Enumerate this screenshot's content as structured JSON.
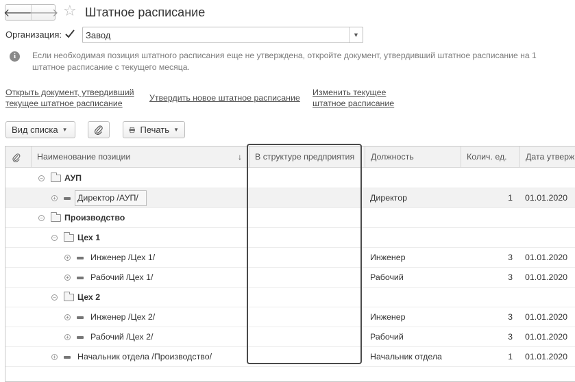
{
  "header": {
    "title": "Штатное расписание",
    "back_icon": "arrow-left-icon",
    "forward_icon": "arrow-right-icon",
    "favorite_icon": "star-icon"
  },
  "organization": {
    "label": "Организация:",
    "checked": true,
    "value": "Завод"
  },
  "info": {
    "line1": "Если необходимая позиция штатного расписания еще не утверждена, откройте документ, утвердивший штатное расписание на 1",
    "line2": "штатное расписание с текущего месяца."
  },
  "links": {
    "open_doc_line1": "Открыть документ, утвердивший",
    "open_doc_line2": "текущее штатное расписание",
    "approve_new": "Утвердить новое штатное расписание",
    "change_line1": "Изменить текущее",
    "change_line2": "штатное расписание"
  },
  "toolbar": {
    "view_list": "Вид списка",
    "attach_icon": "paperclip-icon",
    "print": "Печать"
  },
  "table": {
    "columns": {
      "attach": "paperclip-icon",
      "name": "Наименование позиции",
      "sort": "↓",
      "in_structure": "В структуре предприятия",
      "position": "Должность",
      "units": "Колич. ед.",
      "date": "Дата утверж"
    },
    "rows": [
      {
        "type": "group",
        "name": "АУП",
        "position": "",
        "units": "",
        "date": ""
      },
      {
        "type": "item",
        "name": "Директор /АУП/",
        "position": "Директор",
        "units": "1",
        "date": "01.01.2020"
      },
      {
        "type": "group",
        "name": "Производство",
        "position": "",
        "units": "",
        "date": ""
      },
      {
        "type": "group",
        "name": "Цех 1",
        "position": "",
        "units": "",
        "date": ""
      },
      {
        "type": "item",
        "name": "Инженер /Цех 1/",
        "position": "Инженер",
        "units": "3",
        "date": "01.01.2020"
      },
      {
        "type": "item",
        "name": "Рабочий /Цех 1/",
        "position": "Рабочий",
        "units": "3",
        "date": "01.01.2020"
      },
      {
        "type": "group",
        "name": "Цех 2",
        "position": "",
        "units": "",
        "date": ""
      },
      {
        "type": "item",
        "name": "Инженер /Цех 2/",
        "position": "Инженер",
        "units": "3",
        "date": "01.01.2020"
      },
      {
        "type": "item",
        "name": "Рабочий /Цех 2/",
        "position": "Рабочий",
        "units": "3",
        "date": "01.01.2020"
      },
      {
        "type": "item",
        "name": "Начальник отдела /Производство/",
        "position": "Начальник отдела",
        "units": "1",
        "date": "01.01.2020"
      }
    ]
  }
}
